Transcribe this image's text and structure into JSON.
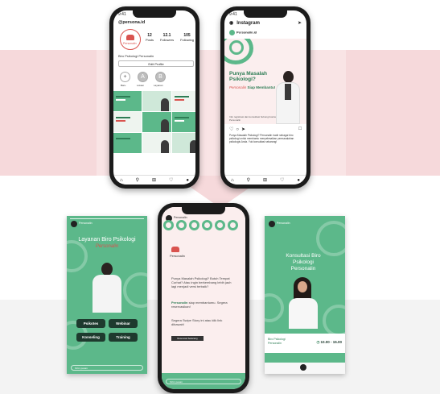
{
  "phone_profile": {
    "time": "9:41",
    "username": "@persona.id",
    "logo_text": "Personalin",
    "stats": [
      {
        "value": "12",
        "label": "Posts"
      },
      {
        "value": "12.1",
        "label": "Followers"
      },
      {
        "value": "105",
        "label": "Following"
      }
    ],
    "bio": "Biro Psikologi Personalin",
    "edit_button": "Edit Profile",
    "highlights": [
      {
        "label": "Baru",
        "glyph": "+"
      },
      {
        "label": "Lokasi",
        "glyph": "A"
      },
      {
        "label": "Layanan",
        "glyph": "B"
      }
    ],
    "tab_icons": [
      "home-icon",
      "search-icon",
      "add-icon",
      "heart-icon",
      "profile-icon"
    ]
  },
  "phone_post": {
    "time": "9:41",
    "app_title": "Instagram",
    "username": "Personalin.id",
    "headline": "Punya Masalah Psikologi?",
    "subline_brand": "Personalin",
    "subline_rest": "Siap Membantu!",
    "small_text": "Info registrasi dan konsultasi hubungi kontak Personalin",
    "caption": "Punya Masalah Psikologi? Personalin hadir sebagai biro psikologi untuk membantu menyelesaikan permasalahan psikologis Anda. Yuk konsultasi sekarang!"
  },
  "story_left": {
    "name": "Personalin",
    "title": "Layanan Biro Psikologi",
    "brand": "Personalin",
    "buttons": [
      "Psikotes",
      "Webinar",
      "Konseling",
      "Training"
    ],
    "reply": "Kirim pesan"
  },
  "story_center": {
    "name": "Personalin",
    "logo_text": "Personalin",
    "para1": "Punya Masalah Psikologi? Butuh Tempat Curhat? Atau ingin berkembang lebih jauh lagi menjadi versi terbaik?",
    "para2_brand": "Personalin",
    "para2_rest": "siap membantumu. Segera reservasikan!",
    "para3": "Segera Swipe Story ini atau klik link dibawah!",
    "button": "Reservasi Sekarang",
    "reply": "Kirim pesan"
  },
  "story_right": {
    "name": "Personalin",
    "title": "Konsultasi Biro Psikologi Personalin",
    "bar_label": "Biro Psikologi Personalin",
    "hours": "10.00 - 15.00"
  },
  "colors": {
    "brand_green": "#5cb88a",
    "dark_green": "#1e3a2e",
    "brand_red": "#d9534f",
    "pink_band": "#f6d9db"
  }
}
